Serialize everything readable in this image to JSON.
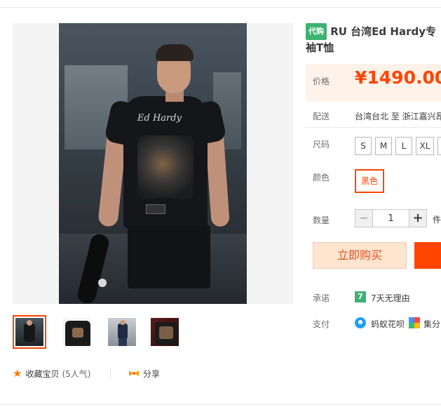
{
  "product": {
    "tag": "代购",
    "title": "RU 台湾Ed Hardy专",
    "title_line2": "袖T恤",
    "image_logo_text": "Ed Hardy"
  },
  "price": {
    "label": "价格",
    "value": "¥1490.00"
  },
  "shipping": {
    "label": "配送",
    "value": "台湾台北 至 浙江嘉兴昂"
  },
  "size": {
    "label": "尺码",
    "options": [
      "S",
      "M",
      "L",
      "XL",
      ""
    ]
  },
  "color": {
    "label": "颜色",
    "selected": "黑色"
  },
  "quantity": {
    "label": "数量",
    "minus": "−",
    "value": "1",
    "plus": "+",
    "unit": "件"
  },
  "actions": {
    "buy_now": "立即购买"
  },
  "promise": {
    "label": "承诺",
    "icon_text": "7",
    "text": "7天无理由"
  },
  "payment": {
    "label": "支付",
    "method1": "蚂蚁花呗",
    "method2": "集分"
  },
  "favorite": {
    "label": "收藏宝贝",
    "count": "(5人气)"
  },
  "share": {
    "label": "分享"
  },
  "colors": {
    "accent": "#ff4400",
    "price_bg": "#fff2e8",
    "tag_green": "#3cb371"
  }
}
